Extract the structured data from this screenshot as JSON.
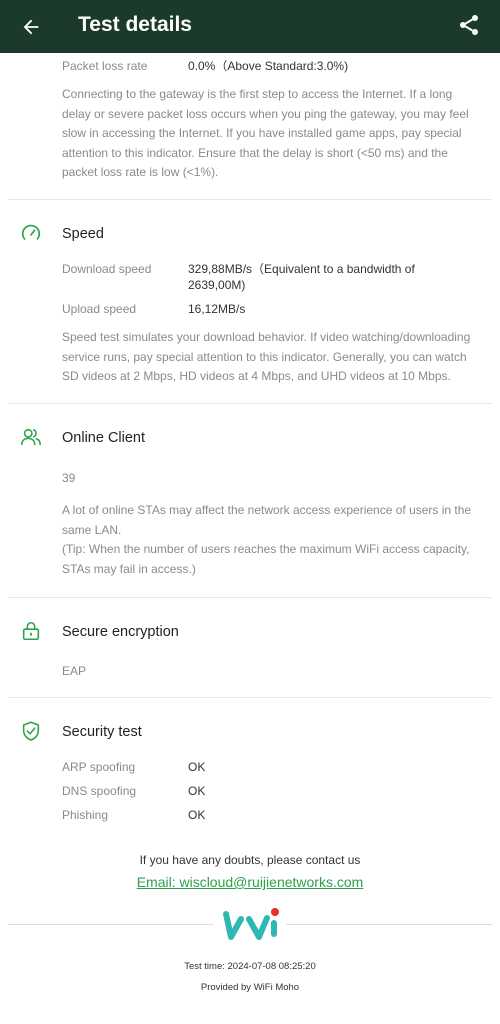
{
  "header": {
    "title": "Test details"
  },
  "gateway": {
    "packet_loss_label": "Packet loss rate",
    "packet_loss_value": "0.0%（Above Standard:3.0%)",
    "description": "Connecting to the gateway is the first step to access the Internet. If a long delay or severe packet loss occurs when you ping the gateway, you may feel slow in accessing the Internet. If you have installed game apps, pay special attention to this indicator. Ensure that the delay is short (<50 ms) and the packet loss rate is low (<1%)."
  },
  "speed": {
    "title": "Speed",
    "download_label": "Download speed",
    "download_value": "329,88MB/s（Equivalent to a bandwidth of 2639,00M)",
    "upload_label": "Upload speed",
    "upload_value": "16,12MB/s",
    "description": "Speed test simulates your download behavior. If video watching/downloading service runs, pay special attention to this indicator. Generally, you can watch SD videos at 2 Mbps, HD videos at 4 Mbps, and UHD videos at 10 Mbps."
  },
  "online_client": {
    "title": "Online Client",
    "count": "39",
    "description": "A lot of online STAs may affect the network access experience of users in the same LAN.",
    "tip": "(Tip: When the number of users reaches the maximum WiFi access capacity, STAs may fail in access.)"
  },
  "encryption": {
    "title": "Secure encryption",
    "value": "EAP"
  },
  "security": {
    "title": "Security test",
    "items": [
      {
        "label": "ARP spoofing",
        "value": "OK"
      },
      {
        "label": "DNS spoofing",
        "value": "OK"
      },
      {
        "label": "Phishing",
        "value": "OK"
      }
    ]
  },
  "footer": {
    "contact_text": "If you have any doubts, please contact us",
    "email_text": "Email: wiscloud@ruijienetworks.com",
    "test_time": "Test time: 2024-07-08 08:25:20",
    "provided_by": "Provided by WiFi Moho"
  },
  "colors": {
    "header_bg": "#1c3a2a",
    "accent": "#2ca24a",
    "logo_teal": "#2fb7b3",
    "logo_red": "#e5322d"
  },
  "icons": {
    "back": "arrow-left-icon",
    "share": "share-icon",
    "speed": "speedometer-icon",
    "online_client": "users-icon",
    "encryption": "lock-icon",
    "security": "shield-check-icon"
  }
}
